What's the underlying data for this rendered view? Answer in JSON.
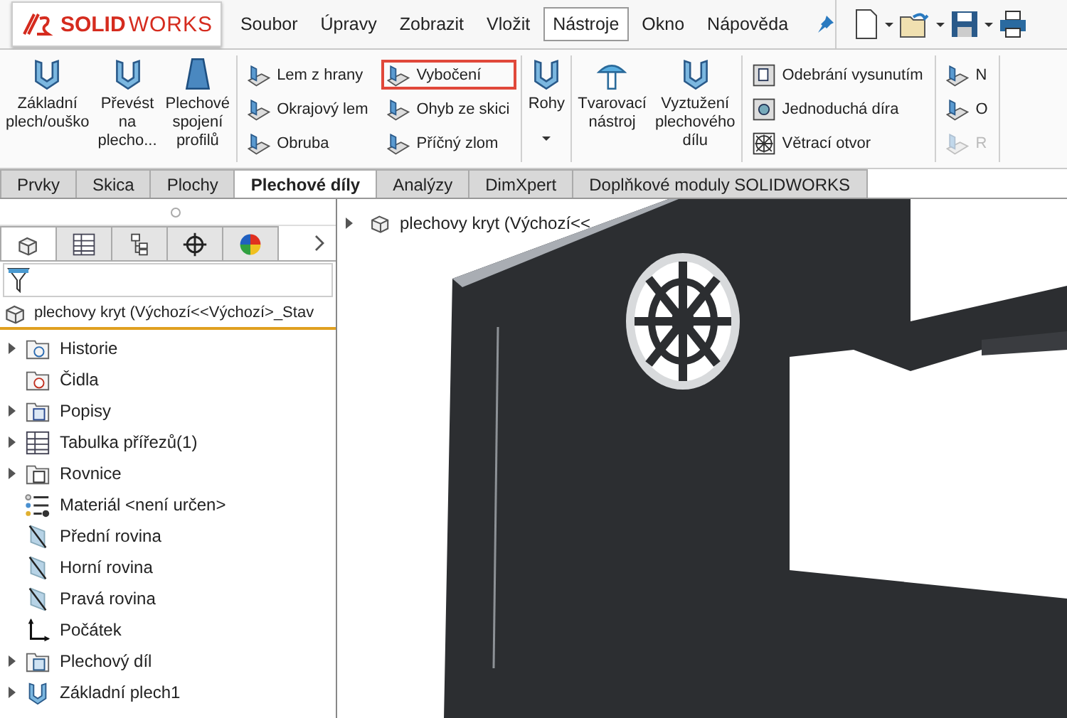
{
  "logo": {
    "text_bold": "SOLID",
    "text_light": "WORKS"
  },
  "menu": [
    {
      "label": "Soubor",
      "selected": false
    },
    {
      "label": "Úpravy",
      "selected": false
    },
    {
      "label": "Zobrazit",
      "selected": false
    },
    {
      "label": "Vložit",
      "selected": false
    },
    {
      "label": "Nástroje",
      "selected": true
    },
    {
      "label": "Okno",
      "selected": false
    },
    {
      "label": "Nápověda",
      "selected": false
    }
  ],
  "ribbon": {
    "groups": [
      {
        "columns": [
          {
            "kind": "large",
            "label": "Základní plech/ouško",
            "dropdown": false
          },
          {
            "kind": "large",
            "label": "Převést na plecho...",
            "dropdown": false
          },
          {
            "kind": "large",
            "label": "Plechové spojení profilů",
            "dropdown": false
          }
        ]
      },
      {
        "columns": [
          {
            "kind": "stack",
            "items": [
              {
                "label": "Lem z hrany",
                "highlighted": false,
                "disabled": false
              },
              {
                "label": "Okrajový lem",
                "highlighted": false,
                "disabled": false
              },
              {
                "label": "Obruba",
                "highlighted": false,
                "disabled": false
              }
            ]
          },
          {
            "kind": "stack",
            "items": [
              {
                "label": "Vybočení",
                "highlighted": true,
                "disabled": false
              },
              {
                "label": "Ohyb ze skici",
                "highlighted": false,
                "disabled": false
              },
              {
                "label": "Příčný zlom",
                "highlighted": false,
                "disabled": false
              }
            ]
          }
        ]
      },
      {
        "columns": [
          {
            "kind": "large",
            "label": "Rohy",
            "dropdown": true
          }
        ]
      },
      {
        "columns": [
          {
            "kind": "large",
            "label": "Tvarovací nástroj",
            "dropdown": false
          },
          {
            "kind": "large",
            "label": "Vyztužení plechového dílu",
            "dropdown": false
          }
        ]
      },
      {
        "columns": [
          {
            "kind": "stack",
            "items": [
              {
                "label": "Odebrání vysunutím",
                "highlighted": false,
                "disabled": false
              },
              {
                "label": "Jednoduchá díra",
                "highlighted": false,
                "disabled": false
              },
              {
                "label": "Větrací otvor",
                "highlighted": false,
                "disabled": false
              }
            ]
          }
        ]
      },
      {
        "columns": [
          {
            "kind": "stack",
            "items": [
              {
                "label": "N",
                "highlighted": false,
                "disabled": false
              },
              {
                "label": "O",
                "highlighted": false,
                "disabled": false
              },
              {
                "label": "R",
                "highlighted": false,
                "disabled": true
              }
            ]
          }
        ]
      }
    ]
  },
  "tabs": [
    {
      "label": "Prvky",
      "selected": false
    },
    {
      "label": "Skica",
      "selected": false
    },
    {
      "label": "Plochy",
      "selected": false
    },
    {
      "label": "Plechové díly",
      "selected": true
    },
    {
      "label": "Analýzy",
      "selected": false
    },
    {
      "label": "DimXpert",
      "selected": false
    },
    {
      "label": "Doplňkové moduly SOLIDWORKS",
      "selected": false
    }
  ],
  "panel_tabs": [
    {
      "selected": true
    },
    {
      "selected": false
    },
    {
      "selected": false
    },
    {
      "selected": false
    },
    {
      "selected": false
    }
  ],
  "tree": {
    "root": "plechovy kryt  (Výchozí<<Výchozí>_Stav",
    "items": [
      {
        "label": "Historie",
        "expandable": true
      },
      {
        "label": "Čidla",
        "expandable": false
      },
      {
        "label": "Popisy",
        "expandable": true
      },
      {
        "label": "Tabulka přířezů(1)",
        "expandable": true
      },
      {
        "label": "Rovnice",
        "expandable": true
      },
      {
        "label": "Materiál <není určen>",
        "expandable": false
      },
      {
        "label": "Přední rovina",
        "expandable": false
      },
      {
        "label": "Horní rovina",
        "expandable": false
      },
      {
        "label": "Pravá rovina",
        "expandable": false
      },
      {
        "label": "Počátek",
        "expandable": false
      },
      {
        "label": "Plechový díl",
        "expandable": true
      },
      {
        "label": "Základní plech1",
        "expandable": true
      }
    ]
  },
  "viewport": {
    "breadcrumb": "plechovy kryt  (Výchozí<<"
  }
}
